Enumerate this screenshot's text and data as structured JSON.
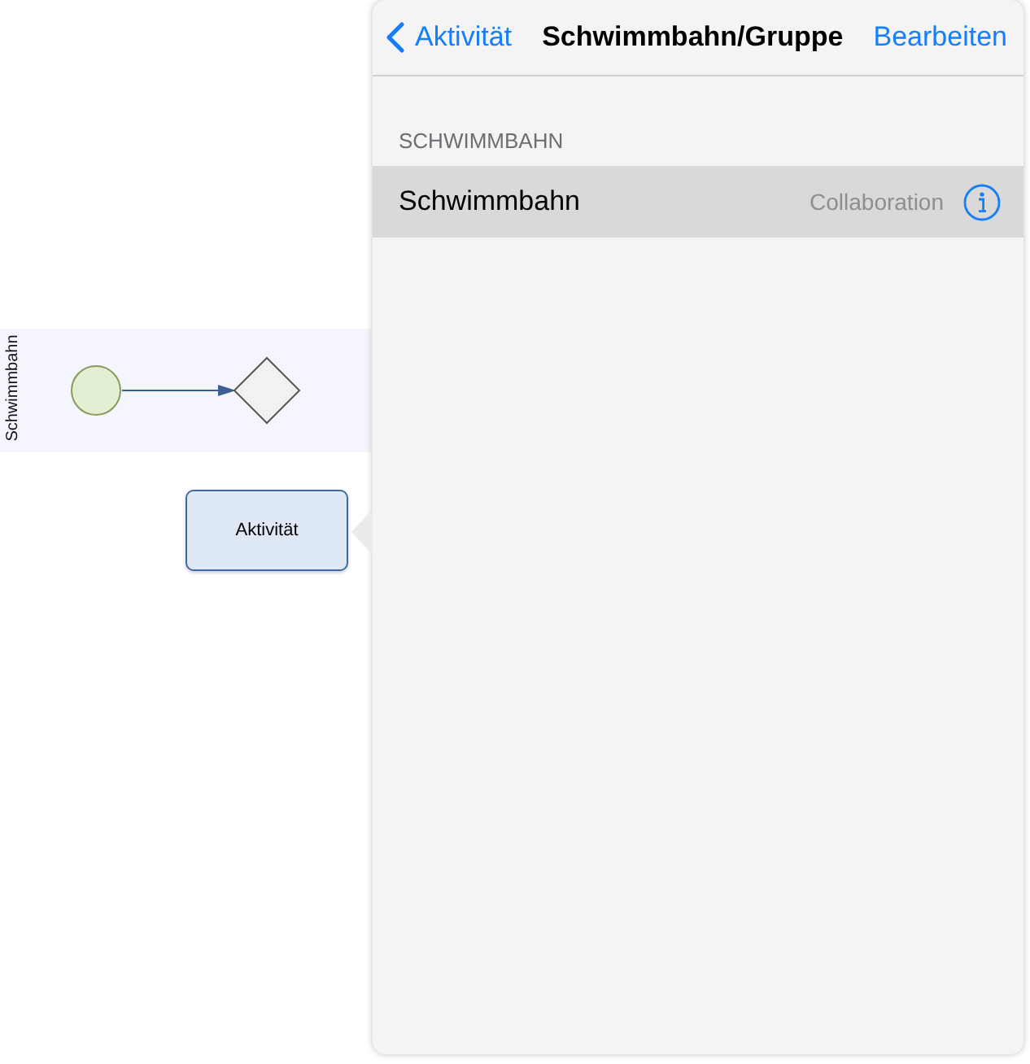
{
  "diagram": {
    "lane": {
      "label": "Schwimmbahn"
    },
    "activity": {
      "label": "Aktivität"
    }
  },
  "popover": {
    "nav_bar": {
      "back": "Aktivität",
      "title": "Schwimmbahn/Gruppe",
      "action": "Bearbeiten"
    },
    "sections": [
      {
        "header": "SCHWIMMBAHN",
        "rows": [
          {
            "title": "Schwimmbahn",
            "detail": "Collaboration",
            "selected": true
          }
        ]
      }
    ]
  }
}
